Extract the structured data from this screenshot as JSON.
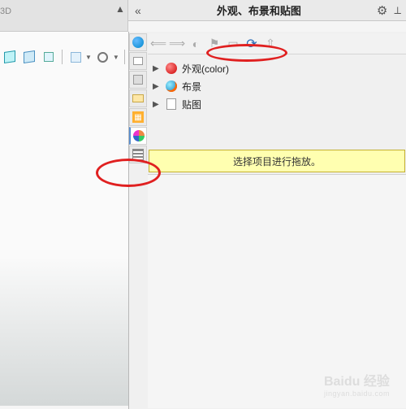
{
  "header": {
    "title": "外观、布景和贴图",
    "collapse": "«"
  },
  "tree": {
    "items": [
      {
        "label": "外观(color)",
        "icon": "redball"
      },
      {
        "label": "布景",
        "icon": "colball"
      },
      {
        "label": "贴图",
        "icon": "sheet"
      }
    ]
  },
  "drop_hint": "选择项目进行拖放。",
  "watermark": {
    "brand": "Baidu 经验",
    "url": "jingyan.baidu.com"
  },
  "top_left_label": "3D"
}
